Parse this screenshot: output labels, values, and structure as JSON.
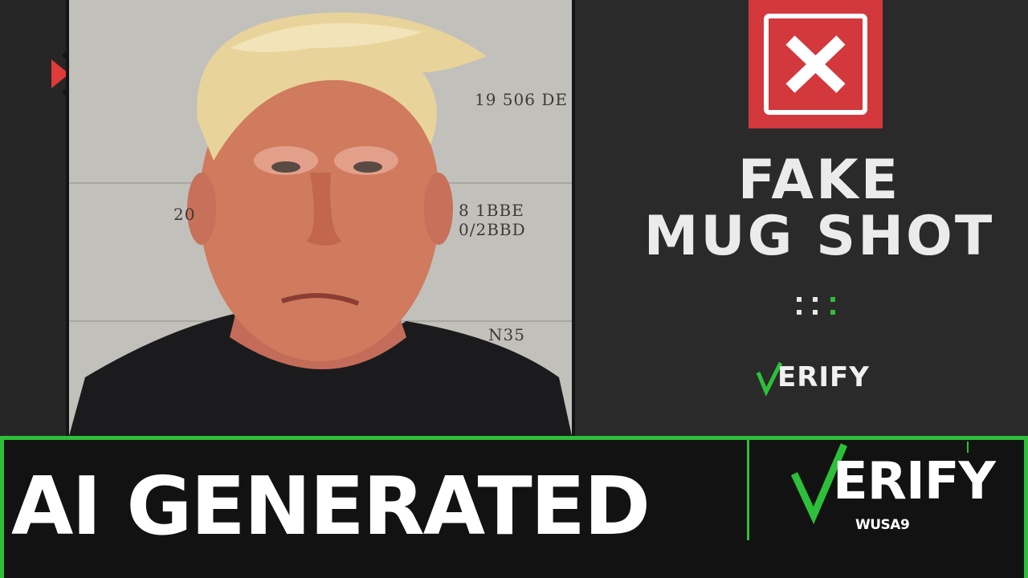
{
  "card": {
    "rating_icon": "x-mark-icon",
    "title_line1": "FAKE",
    "title_line2": "MUG SHOT",
    "verify_logo_small": "ERIFY"
  },
  "photo": {
    "wall_text_top": "19 506 DE",
    "wall_text_mid_left": "20",
    "wall_text_mid_right": "8 1BBE 0/2BBD",
    "wall_text_bottom": "N35"
  },
  "banner": {
    "headline": "AI GENERATED",
    "verify_logo": "ERIFY",
    "station": "WUSA9"
  },
  "colors": {
    "accent_green": "#2dbf3a",
    "rating_red": "#d2383c",
    "play_red": "#e03a3a"
  }
}
